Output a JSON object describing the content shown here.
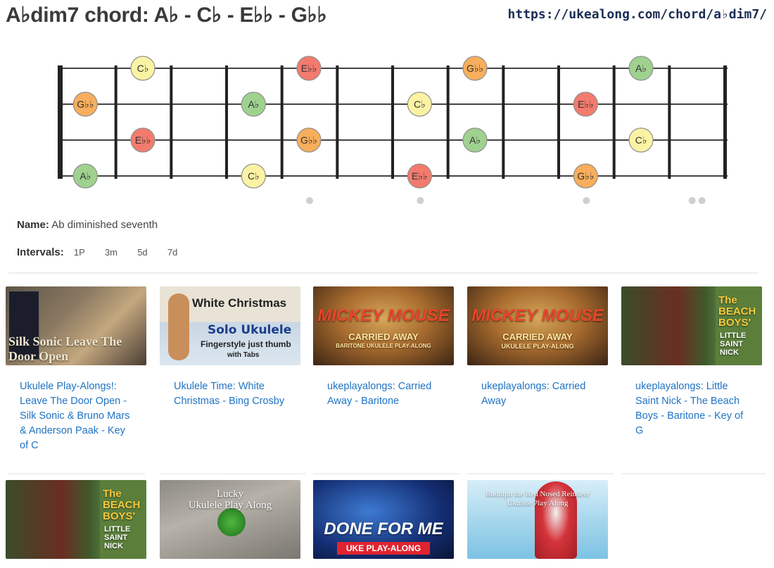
{
  "title": "A♭dim7 chord: A♭ - C♭ - E♭♭ - G♭♭",
  "url": "https://ukealong.com/chord/a♭dim7/",
  "fretboard": {
    "strings": 4,
    "frets": 12,
    "fret_markers": [
      5,
      7,
      10,
      12
    ],
    "note_colors": {
      "root": "#9fd18f",
      "third": "#fbf3a3",
      "fifth": "#f37b6e",
      "seventh": "#f8ae5c"
    },
    "notes": [
      {
        "string": 1,
        "fret": 1,
        "label": "C♭",
        "role": "third"
      },
      {
        "string": 1,
        "fret": 4,
        "label": "E♭♭",
        "role": "fifth"
      },
      {
        "string": 1,
        "fret": 7,
        "label": "G♭♭",
        "role": "seventh"
      },
      {
        "string": 1,
        "fret": 10,
        "label": "A♭",
        "role": "root"
      },
      {
        "string": 2,
        "fret": 0,
        "label": "G♭♭",
        "role": "seventh"
      },
      {
        "string": 2,
        "fret": 3,
        "label": "A♭",
        "role": "root"
      },
      {
        "string": 2,
        "fret": 6,
        "label": "C♭",
        "role": "third"
      },
      {
        "string": 2,
        "fret": 9,
        "label": "E♭♭",
        "role": "fifth"
      },
      {
        "string": 3,
        "fret": 1,
        "label": "E♭♭",
        "role": "fifth"
      },
      {
        "string": 3,
        "fret": 4,
        "label": "G♭♭",
        "role": "seventh"
      },
      {
        "string": 3,
        "fret": 7,
        "label": "A♭",
        "role": "root"
      },
      {
        "string": 3,
        "fret": 10,
        "label": "C♭",
        "role": "third"
      },
      {
        "string": 4,
        "fret": 0,
        "label": "A♭",
        "role": "root"
      },
      {
        "string": 4,
        "fret": 3,
        "label": "C♭",
        "role": "third"
      },
      {
        "string": 4,
        "fret": 6,
        "label": "E♭♭",
        "role": "fifth"
      },
      {
        "string": 4,
        "fret": 9,
        "label": "G♭♭",
        "role": "seventh"
      }
    ]
  },
  "info": {
    "name_label": "Name:",
    "name_value": "Ab diminished seventh",
    "intervals_label": "Intervals:",
    "intervals": [
      "1P",
      "3m",
      "5d",
      "7d"
    ]
  },
  "videos": [
    {
      "title": "Ukulele Play-Alongs!: Leave The Door Open - Silk Sonic & Bruno Mars & Anderson Paak - Key of C",
      "thumb_text": "Silk Sonic  Leave The Door Open"
    },
    {
      "title": "Ukulele Time: White Christmas - Bing Crosby",
      "thumb_text": "White Christmas",
      "thumb_sub": "Solo Ukulele",
      "thumb_sub2": "Fingerstyle just thumb",
      "thumb_sub3": "with Tabs"
    },
    {
      "title": "ukeplayalongs: Carried Away - Baritone",
      "thumb_text": "MICKEY MOUSE",
      "thumb_sub": "CARRIED AWAY",
      "thumb_sub2": "BARITONE UKULELE PLAY-ALONG"
    },
    {
      "title": "ukeplayalongs: Carried Away",
      "thumb_text": "MICKEY MOUSE",
      "thumb_sub": "CARRIED AWAY",
      "thumb_sub2": "UKULELE PLAY-ALONG"
    },
    {
      "title": "ukeplayalongs: Little Saint Nick - The Beach Boys - Baritone - Key of G",
      "thumb_text": "The BEACH BOYS'",
      "thumb_sub": "LITTLE SAINT NICK"
    },
    {
      "title": "",
      "thumb_text": "The BEACH BOYS'",
      "thumb_sub": "LITTLE SAINT NICK"
    },
    {
      "title": "",
      "thumb_text": "Lucky",
      "thumb_sub": "Ukulele Play Along"
    },
    {
      "title": "",
      "thumb_text": "DONE FOR ME",
      "thumb_sub": "UKE PLAY-ALONG"
    },
    {
      "title": "",
      "thumb_text": "Rudolph the Red Nosed Reindeer",
      "thumb_sub": "Ukulele Play Along"
    }
  ]
}
